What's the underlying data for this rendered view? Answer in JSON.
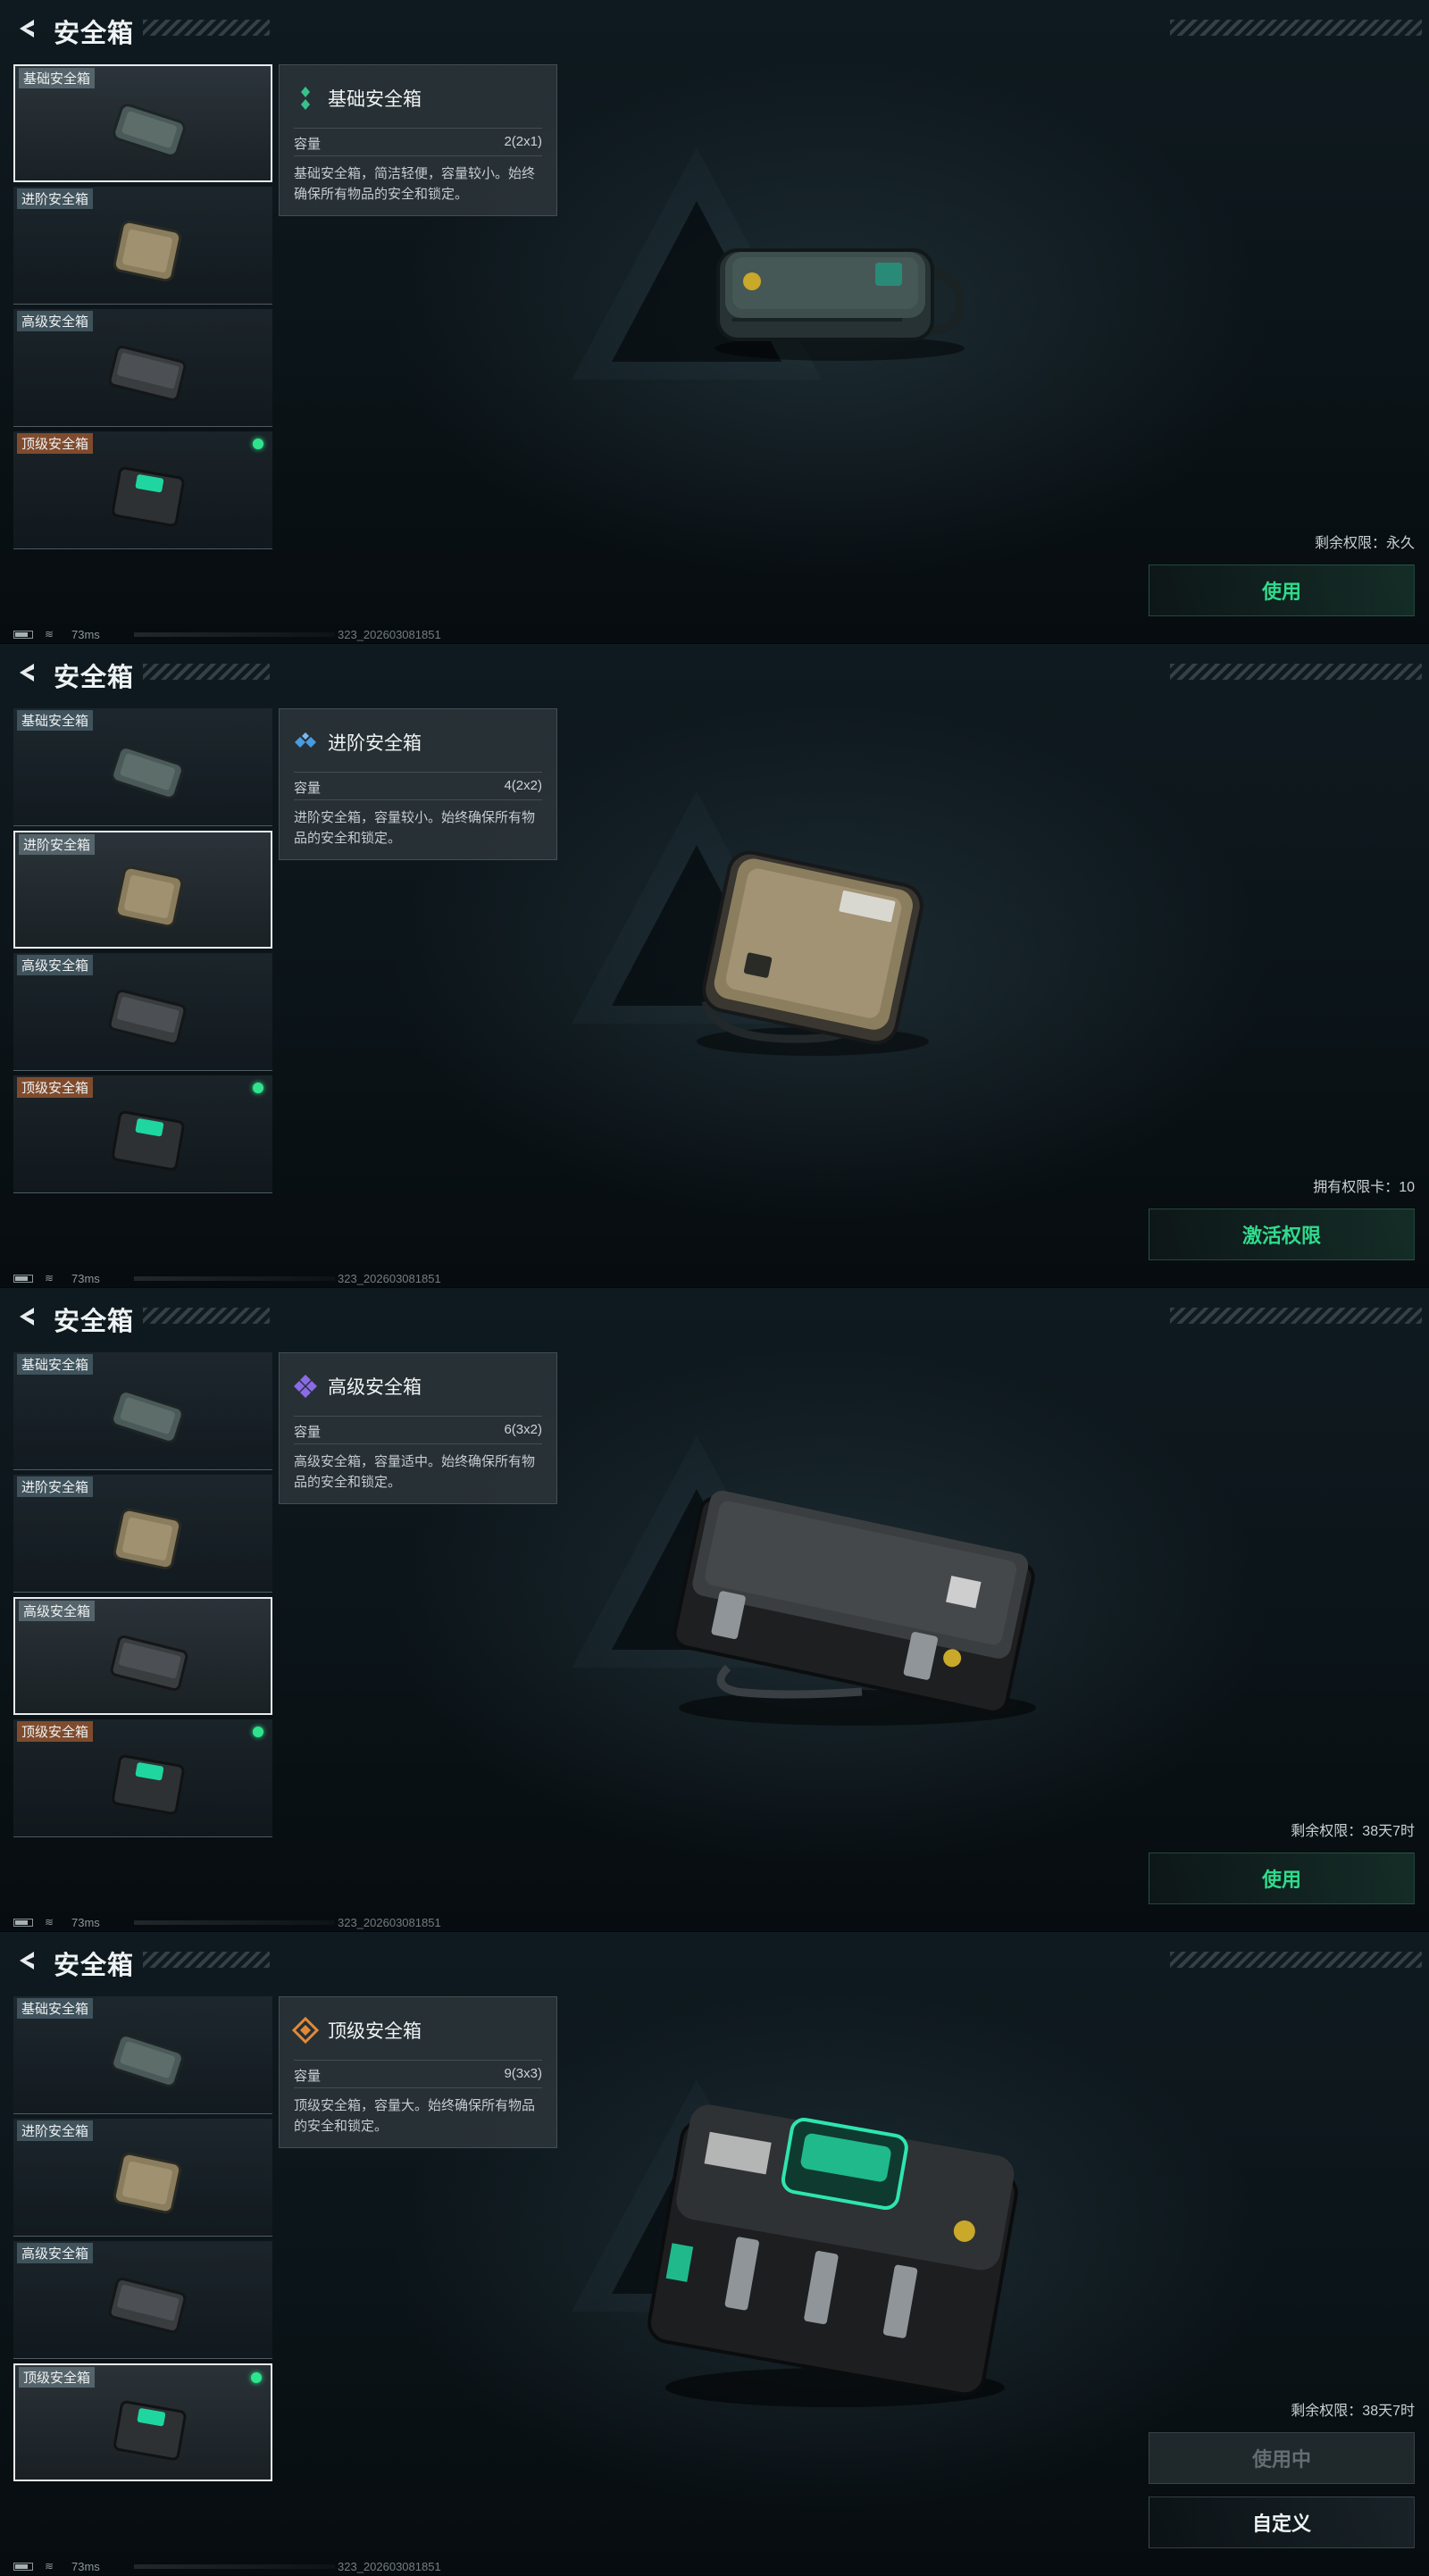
{
  "panels": [
    {
      "title": "安全箱",
      "items": [
        {
          "label": "基础安全箱"
        },
        {
          "label": "进阶安全箱"
        },
        {
          "label": "高级安全箱"
        },
        {
          "label": "顶级安全箱"
        }
      ],
      "info": {
        "name": "基础安全箱",
        "capacity_label": "容量",
        "capacity_value": "2(2x1)",
        "description": "基础安全箱，简洁轻便，容量较小。始终确保所有物品的安全和锁定。"
      },
      "status": "剩余权限：永久",
      "button": "使用",
      "ping": "73ms",
      "version": "323_202603081851"
    },
    {
      "title": "安全箱",
      "items": [
        {
          "label": "基础安全箱"
        },
        {
          "label": "进阶安全箱"
        },
        {
          "label": "高级安全箱"
        },
        {
          "label": "顶级安全箱"
        }
      ],
      "info": {
        "name": "进阶安全箱",
        "capacity_label": "容量",
        "capacity_value": "4(2x2)",
        "description": "进阶安全箱，容量较小。始终确保所有物品的安全和锁定。"
      },
      "status": "拥有权限卡：10",
      "button": "激活权限",
      "ping": "73ms",
      "version": "323_202603081851"
    },
    {
      "title": "安全箱",
      "items": [
        {
          "label": "基础安全箱"
        },
        {
          "label": "进阶安全箱"
        },
        {
          "label": "高级安全箱"
        },
        {
          "label": "顶级安全箱"
        }
      ],
      "info": {
        "name": "高级安全箱",
        "capacity_label": "容量",
        "capacity_value": "6(3x2)",
        "description": "高级安全箱，容量适中。始终确保所有物品的安全和锁定。"
      },
      "status": "剩余权限：38天7时",
      "button": "使用",
      "ping": "73ms",
      "version": "323_202603081851"
    },
    {
      "title": "安全箱",
      "items": [
        {
          "label": "基础安全箱"
        },
        {
          "label": "进阶安全箱"
        },
        {
          "label": "高级安全箱"
        },
        {
          "label": "顶级安全箱"
        }
      ],
      "info": {
        "name": "顶级安全箱",
        "capacity_label": "容量",
        "capacity_value": "9(3x3)",
        "description": "顶级安全箱，容量大。始终确保所有物品的安全和锁定。"
      },
      "status": "剩余权限：38天7时",
      "button": "使用中",
      "button2": "自定义",
      "ping": "73ms",
      "version": "323_202603081851"
    }
  ],
  "icons": {
    "back": "back-arrow-icon",
    "rarity_basic": "green-diamond-icon",
    "rarity_advanced": "blue-diamond-icon",
    "rarity_premium": "purple-diamond-icon",
    "rarity_top": "orange-diamond-icon",
    "equipped": "green-dot-icon"
  },
  "colors": {
    "accent_green": "#2fdc8c",
    "basic": "#35c28a",
    "advanced": "#4a9be0",
    "premium": "#8a6ae6",
    "top": "#e0893a"
  }
}
